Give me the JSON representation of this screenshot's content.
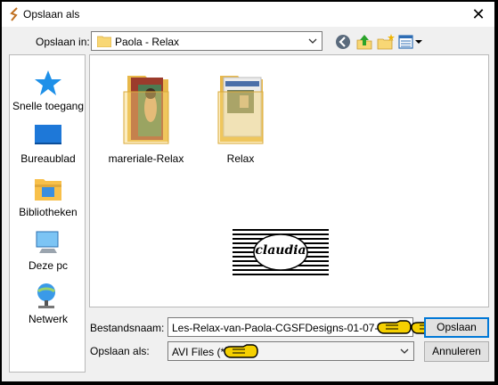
{
  "window": {
    "title": "Opslaan als",
    "close_glyph": "✕"
  },
  "save_in": {
    "label": "Opslaan in:",
    "value": "Paola - Relax",
    "folder_icon": "folder-icon"
  },
  "toolbar": [
    "back-icon",
    "up-folder-icon",
    "new-folder-icon",
    "view-menu-icon"
  ],
  "places": [
    {
      "label": "Snelle toegang",
      "icon": "quick-access-star-icon"
    },
    {
      "label": "Bureaublad",
      "icon": "desktop-icon"
    },
    {
      "label": "Bibliotheken",
      "icon": "libraries-icon"
    },
    {
      "label": "Deze pc",
      "icon": "pc-icon"
    },
    {
      "label": "Netwerk",
      "icon": "network-icon"
    }
  ],
  "folders": [
    {
      "name": "mareriale-Relax"
    },
    {
      "name": "Relax"
    }
  ],
  "watermark": {
    "text": "claudia"
  },
  "filename": {
    "label": "Bestandsnaam:",
    "value": "Les-Relax-van-Paola-CGSFDesigns-01-07-2021"
  },
  "filetype": {
    "label": "Opslaan als:",
    "value": "AVI Files (*.avi)"
  },
  "buttons": {
    "save": "Opslaan",
    "cancel": "Annuleren"
  },
  "colors": {
    "accent": "#0078d7",
    "folder": "#f8d775",
    "star": "#1e90e8",
    "pointer_hand": "#f5d000"
  }
}
